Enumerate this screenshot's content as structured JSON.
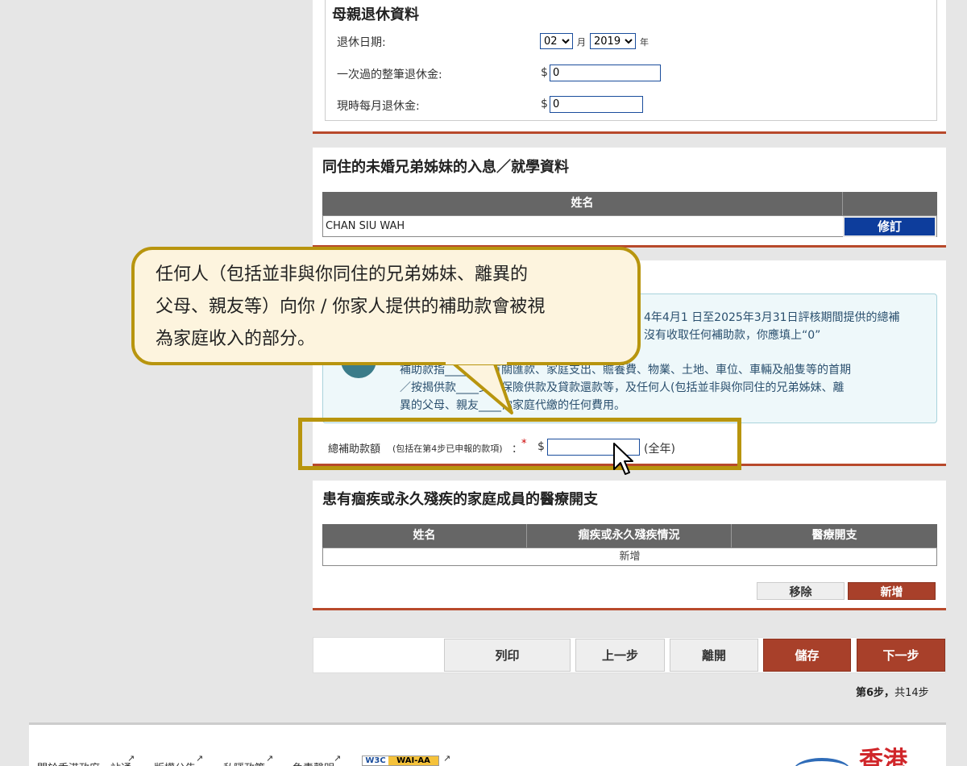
{
  "mother_retirement": {
    "title": "母親退休資料",
    "retire_date_label": "退休日期:",
    "month_value": "02",
    "month_unit": "月",
    "year_value": "2019",
    "year_unit": "年",
    "lump_sum_label": "一次過的整筆退休金:",
    "lump_sum_currency": "$",
    "lump_sum_value": "0",
    "monthly_label": "現時每月退休金:",
    "monthly_currency": "$",
    "monthly_value": "0"
  },
  "siblings": {
    "title": "同住的未婚兄弟姊妹的入息／就學資料",
    "col_name": "姓名",
    "rows": [
      {
        "name": "CHAN SIU WAH",
        "action": "修訂"
      }
    ]
  },
  "subsidy": {
    "info_line1_tail": "4年4月1 日至2025年3月31日評核期間提供的總補",
    "info_line2_tail": "沒有收取任何補助款，你應填上“0”",
    "info_line3": "補助款指____款的有關匯款、家庭支出、贍養費、物業、土地、車位、車輛及船隻等的首期",
    "info_line4": "／按揭供款____支、保險供款及貸款還款等，及任何人(包括並非與你同住的兄弟姊妹、離",
    "info_line5": "異的父母、親友____你家庭代繳的任何費用。",
    "total_label": "總補助款額",
    "total_note": "(包括在第4步已申報的款項)",
    "colon": "：",
    "required": "*",
    "currency": "$",
    "value": "",
    "period": "(全年)"
  },
  "callout": {
    "text": "任何人（包括並非與你同住的兄弟姊妹、離異的父母、親友等）向你 / 你家人提供的補助款會被視為家庭收入的部分。",
    "line1": "任何人（包括並非與你同住的兄弟姊妹、離異的",
    "line2": "父母、親友等）向你 / 你家人提供的補助款會被視",
    "line3": "為家庭收入的部分。"
  },
  "medical": {
    "title": "患有痼疾或永久殘疾的家庭成員的醫療開支",
    "col_name": "姓名",
    "col_condition": "痼疾或永久殘疾情況",
    "col_expense": "醫療開支",
    "empty_row": "新增",
    "remove_label": "移除",
    "add_label": "新增"
  },
  "nav": {
    "print": "列印",
    "prev": "上一步",
    "leave": "離開",
    "save": "儲存",
    "next": "下一步",
    "step_current": "第6步",
    "step_sep": "，",
    "step_total": "共14步"
  },
  "footer": {
    "links": [
      "關於香港政府一站通",
      "版權公告",
      "私隱政策",
      "免責聲明"
    ],
    "wai_label": "WAI-AA",
    "w3c_label": "W3C",
    "logo_text": "香港"
  },
  "colors": {
    "accent_red": "#a8402a",
    "callout_border": "#b8950e",
    "callout_bg": "#fdf4de",
    "link_blue": "#0d3d9c"
  }
}
